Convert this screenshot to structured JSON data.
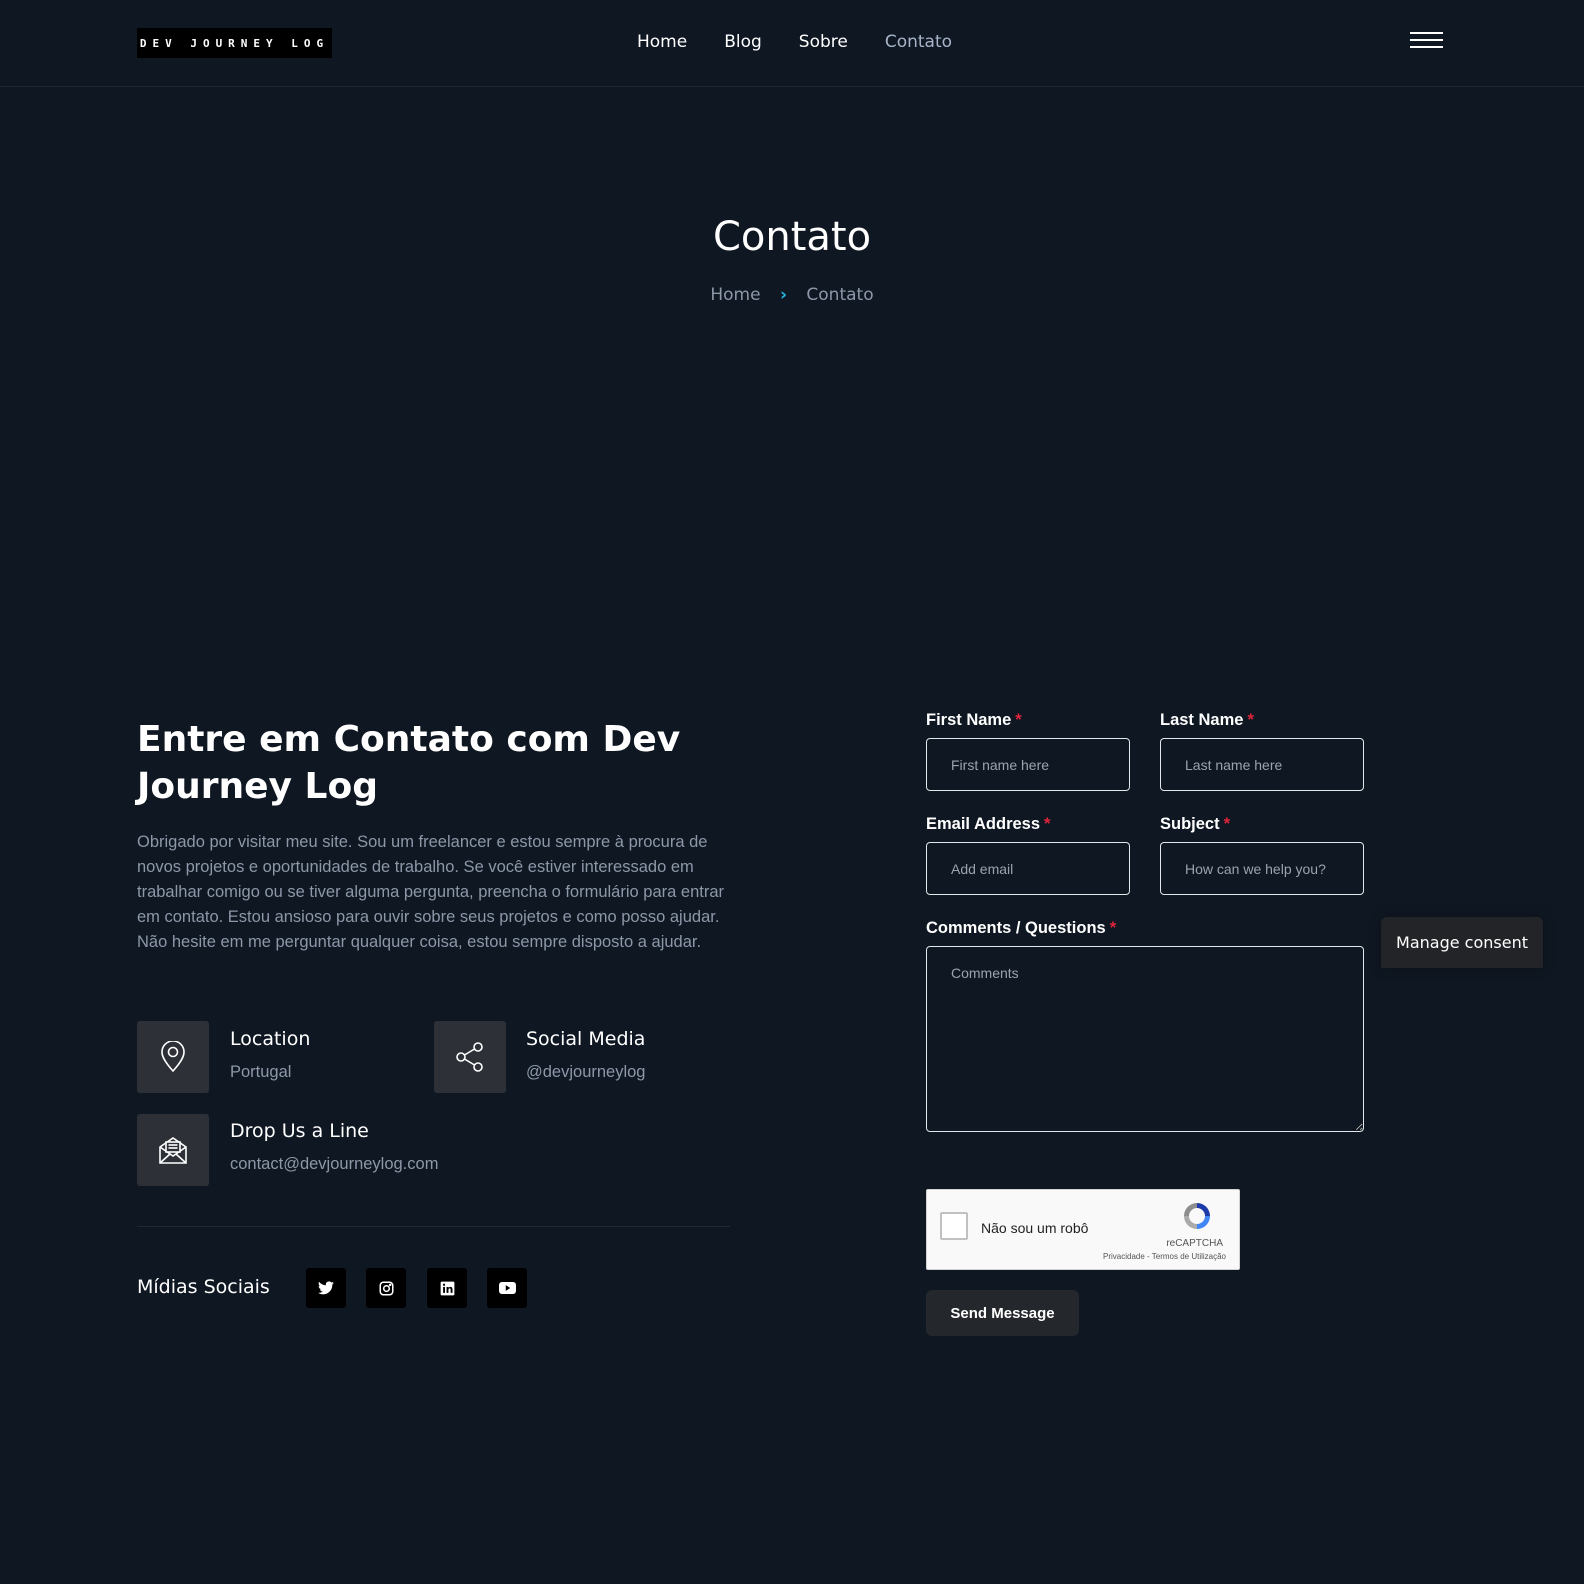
{
  "header": {
    "logo": "DEV JOURNEY LOG",
    "nav": [
      "Home",
      "Blog",
      "Sobre",
      "Contato"
    ],
    "active_nav": "Contato"
  },
  "hero": {
    "title": "Contato",
    "breadcrumb": {
      "home": "Home",
      "current": "Contato"
    }
  },
  "intro": {
    "heading": "Entre em Contato com Dev Journey Log",
    "text": "Obrigado por visitar meu site. Sou um freelancer e estou sempre à procura de novos projetos e oportunidades de trabalho. Se você estiver interessado em trabalhar comigo ou se tiver alguma pergunta, preencha o formulário para entrar em contato. Estou ansioso para ouvir sobre seus projetos e como posso ajudar. Não hesite em me perguntar qualquer coisa, estou sempre disposto a ajudar."
  },
  "info": {
    "location": {
      "title": "Location",
      "value": "Portugal",
      "icon": "map-pin-icon"
    },
    "social": {
      "title": "Social Media",
      "value": "@devjourneylog",
      "icon": "share-icon"
    },
    "email": {
      "title": "Drop Us a Line",
      "value": "contact@devjourneylog.com",
      "icon": "mail-icon"
    }
  },
  "social_media": {
    "title": "Mídias Sociais",
    "icons": [
      "twitter-icon",
      "instagram-icon",
      "linkedin-icon",
      "youtube-icon"
    ]
  },
  "form": {
    "first_name": {
      "label": "First Name",
      "placeholder": "First name here",
      "required": "*"
    },
    "last_name": {
      "label": "Last Name",
      "placeholder": "Last name here",
      "required": "*"
    },
    "email": {
      "label": "Email Address",
      "placeholder": "Add email",
      "required": "*"
    },
    "subject": {
      "label": "Subject",
      "placeholder": "How can we help you?",
      "required": "*"
    },
    "comments": {
      "label": "Comments / Questions",
      "placeholder": "Comments",
      "required": "*"
    },
    "recaptcha": {
      "label": "Não sou um robô",
      "brand": "reCAPTCHA",
      "terms": "Privacidade - Termos de Utilização"
    },
    "submit": "Send Message"
  },
  "consent": {
    "label": "Manage consent"
  },
  "colors": {
    "background": "#0f1722",
    "accent": "#22b8e0",
    "required": "#e0243b",
    "muted_text": "#8c97a8"
  }
}
